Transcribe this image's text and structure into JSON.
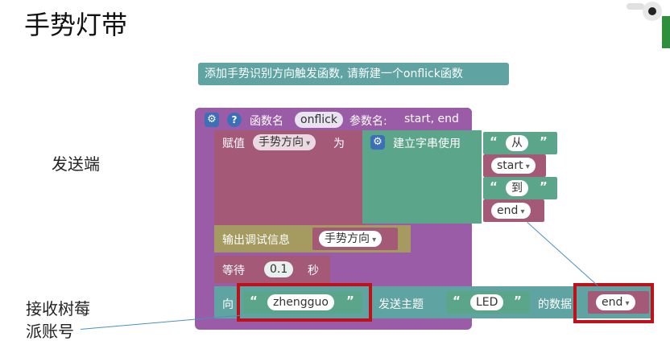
{
  "page": {
    "title": "手势灯带"
  },
  "labels": {
    "sender": "发送端",
    "receiver_line1": "接收树莓",
    "receiver_line2": "派账号"
  },
  "comment": "添加手势识别方向触发函数, 请新建一个onflick函数",
  "function": {
    "prefix": "函数名",
    "name": "onflick",
    "params_label": "参数名:",
    "params": "start, end"
  },
  "assign": {
    "label": "赋值",
    "var": "手势方向",
    "as": "为",
    "join_label": "建立字串使用",
    "items": [
      "从",
      "start",
      "到",
      "end"
    ]
  },
  "print": {
    "label": "输出调试信息",
    "var": "手势方向"
  },
  "wait": {
    "label": "等待",
    "value": "0.1",
    "unit": "秒"
  },
  "send": {
    "to_label": "向",
    "account": "zhengguo",
    "topic_label": "发送主题",
    "topic": "LED",
    "data_label": "的数据",
    "data": "end"
  },
  "colors": {
    "procedure": "#9a5ca6",
    "variable": "#a45a76",
    "text": "#5ba58a",
    "io": "#5fa3a3",
    "debug": "#a59a5f",
    "highlight": "#c0101a"
  }
}
